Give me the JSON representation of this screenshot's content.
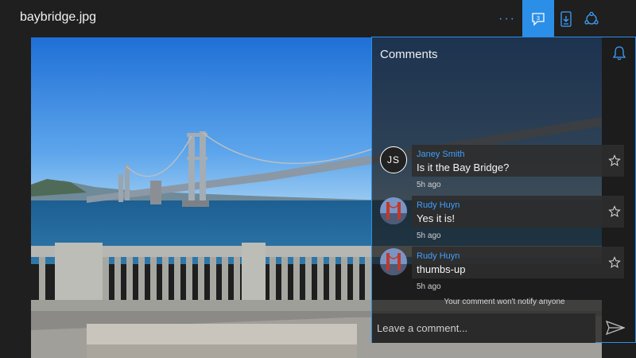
{
  "window": {
    "title": "baybridge.jpg"
  },
  "toolbar": {
    "more_label": "···",
    "comments_count": "3",
    "icons": [
      "more-icon",
      "comments-icon",
      "download-icon",
      "share-icon"
    ],
    "accent": "#2b8fe8"
  },
  "comments_pane": {
    "title": "Comments",
    "notify_text": "Your comment won't notify anyone",
    "input_placeholder": "Leave a comment...",
    "items": [
      {
        "author": "Janey Smith",
        "initials": "JS",
        "text": "Is it the Bay Bridge?",
        "time": "5h ago"
      },
      {
        "author": "Rudy Huyn",
        "initials": "",
        "text": "Yes it is!",
        "time": "5h ago"
      },
      {
        "author": "Rudy Huyn",
        "initials": "",
        "text": "thumbs-up",
        "time": "5h ago"
      }
    ]
  },
  "colors": {
    "link": "#3ea0ff",
    "accent": "#2b8fe8",
    "background": "#1f1f1f"
  }
}
